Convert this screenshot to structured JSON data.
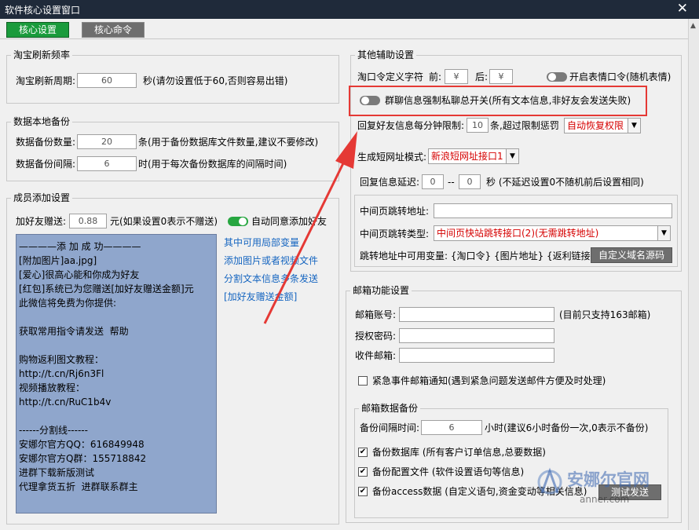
{
  "window": {
    "title": "软件核心设置窗口",
    "close": "✕"
  },
  "tabs": [
    {
      "label": "核心设置"
    },
    {
      "label": "核心命令"
    }
  ],
  "taobao": {
    "group": "淘宝刷新频率",
    "label": "淘宝刷新周期:",
    "value": "60",
    "hint": "秒(请勿设置低于60,否则容易出错)"
  },
  "backup": {
    "group": "数据本地备份",
    "count_label": "数据备份数量:",
    "count_value": "20",
    "count_hint": "条(用于备份数据库文件数量,建议不要修改)",
    "interval_label": "数据备份间隔:",
    "interval_value": "6",
    "interval_hint": "时(用于每次备份数据库的间隔时间)"
  },
  "member": {
    "group": "成员添加设置",
    "gift_label": "加好友赠送:",
    "gift_value": "0.88",
    "gift_hint": "元(如果设置0表示不赠送)",
    "auto_accept": "自动同意添加好友",
    "message_lines": [
      "————添 加 成 功————",
      "[附加图片]aa.jpg]",
      "[爱心]很高心能和你成为好友",
      "[红包]系统已为您赠送[加好友赠送金额]元",
      "此微信将免费为你提供:",
      "",
      "获取常用指令请发送  帮助",
      "",
      "购物返利图文教程：",
      "http://t.cn/Rj6n3Fl",
      "视频播放教程：",
      "http://t.cn/RuC1b4v",
      "",
      "------分割线------",
      "安娜尔官方QQ：616849948",
      "安娜尔官方Q群：155718842",
      "进群下载新版测试",
      "代理拿货五折  进群联系群主"
    ],
    "links": [
      "其中可用局部变量",
      "添加图片或者视频文件",
      "分割文本信息多条发送",
      "[加好友赠送金额]"
    ]
  },
  "other": {
    "group": "其他辅助设置",
    "cmd_label": "淘口令定义字符",
    "front_label": "前:",
    "front_value": "¥",
    "back_label": "后:",
    "back_value": "¥",
    "emoji_toggle": "开启表情口令(随机表情)",
    "group_switch": "群聊信息强制私聊总开关(所有文本信息,非好友会发送失败)",
    "limit_label": "回复好友信息每分钟限制:",
    "limit_value": "10",
    "limit_hint": "条,超过限制惩罚",
    "limit_option": "自动恢复权限",
    "short_label": "生成短网址模式:",
    "short_option": "新浪短网址接口1",
    "delay_label": "回复信息延迟:",
    "delay_from": "0",
    "delay_sep": "--",
    "delay_to": "0",
    "delay_hint": "秒 (不延迟设置0不随机前后设置相同)",
    "mid_addr_label": "中间页跳转地址:",
    "mid_addr_value": "",
    "mid_type_label": "中间页跳转类型:",
    "mid_type_option": "中间页快站跳转接口(2)(无需跳转地址)",
    "vars_text": "跳转地址中可用变量: {淘口令} {图片地址} {返利链接}",
    "custom_btn": "自定义域名源码"
  },
  "mail": {
    "group": "邮箱功能设置",
    "account_label": "邮箱账号:",
    "account_value": "",
    "account_hint": "(目前只支持163邮箱)",
    "auth_label": "授权密码:",
    "auth_value": "",
    "recv_label": "收件邮箱:",
    "recv_value": "",
    "urgent": "紧急事件邮箱通知(遇到紧急问题发送邮件方便及时处理)",
    "backup_group": "邮箱数据备份",
    "interval_label": "备份间隔时间:",
    "interval_value": "6",
    "interval_hint": "小时(建议6小时备份一次,0表示不备份)",
    "db_backup": "备份数据库  (所有客户订单信息,总要数据)",
    "cfg_backup": "备份配置文件  (软件设置语句等信息)",
    "access_backup": "备份access数据  (自定义语句,资金变动等相关信息)",
    "test_btn": "测试发送"
  },
  "watermark": {
    "brand": "安娜尔官网",
    "domain": "anner.com"
  },
  "colors": {
    "accent_green": "#1a9b3c",
    "red_option": "#d50000",
    "arrow_red": "#e53935",
    "message_bg": "#8fa6cc"
  }
}
